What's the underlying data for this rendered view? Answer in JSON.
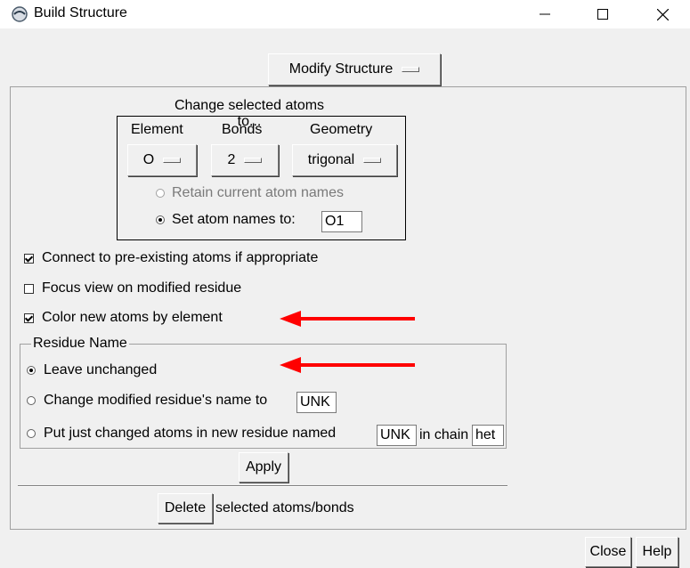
{
  "window": {
    "title": "Build Structure"
  },
  "mode_menu": {
    "label": "Modify Structure"
  },
  "change_section": {
    "heading": "Change selected atoms to...",
    "element_label": "Element",
    "bonds_label": "Bonds",
    "geometry_label": "Geometry",
    "element_value": "O",
    "bonds_value": "2",
    "geometry_value": "trigonal",
    "retain_names_label": "Retain current atom names",
    "set_names_label": "Set atom names to:",
    "set_names_value": "O1",
    "retain_names_selected": false,
    "retain_names_enabled": false,
    "set_names_selected": true
  },
  "options": {
    "connect_label": "Connect to pre-existing atoms if appropriate",
    "connect_checked": true,
    "focus_label": "Focus view on modified residue",
    "focus_checked": false,
    "color_label": "Color new atoms by element",
    "color_checked": true
  },
  "residue_name": {
    "group_title": "Residue Name",
    "leave_label": "Leave unchanged",
    "leave_selected": true,
    "change_label": "Change modified residue's name to",
    "change_value": "UNK",
    "put_label": "Put just changed atoms in new residue named",
    "put_value": "UNK",
    "in_chain_label": "in chain",
    "chain_value": "het"
  },
  "apply_label": "Apply",
  "delete_button_label": "Delete",
  "delete_suffix": "selected atoms/bonds",
  "close_label": "Close",
  "help_label": "Help",
  "colors": {
    "annotation_arrow": "#ff0000",
    "background": "#f0f0f0"
  },
  "icons": [
    "app-icon",
    "minimize-icon",
    "maximize-icon",
    "close-icon"
  ]
}
